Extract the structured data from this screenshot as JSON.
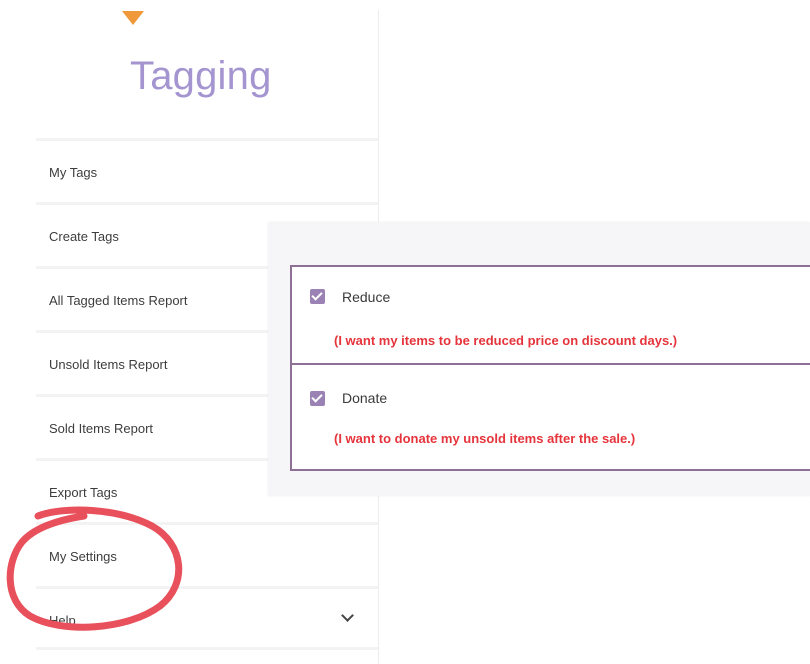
{
  "app": {
    "title": "Tagging",
    "logo_icon": "triangle-down-icon",
    "logo_color": "#f0993a",
    "title_color": "#a494d0"
  },
  "sidebar": {
    "items": [
      {
        "label": "My Tags"
      },
      {
        "label": "Create Tags"
      },
      {
        "label": "All Tagged Items Report"
      },
      {
        "label": "Unsold Items Report"
      },
      {
        "label": "Sold Items Report"
      },
      {
        "label": "Export Tags"
      },
      {
        "label": "My Settings",
        "highlighted": true
      },
      {
        "label": "Help",
        "icon": "chevron-down-icon"
      }
    ]
  },
  "settings": {
    "options": [
      {
        "label": "Reduce",
        "checked": true,
        "note": "(I want my items to be reduced price on discount days.)"
      },
      {
        "label": "Donate",
        "checked": true,
        "note": "(I want to donate my unsold items after the sale.)"
      }
    ],
    "accent_color": "#9b82b4",
    "border_color": "#8e6f95",
    "note_color": "#e5343b"
  },
  "annotation": {
    "shape": "hand-drawn-circle",
    "color": "#e8505b",
    "target": "My Settings"
  }
}
